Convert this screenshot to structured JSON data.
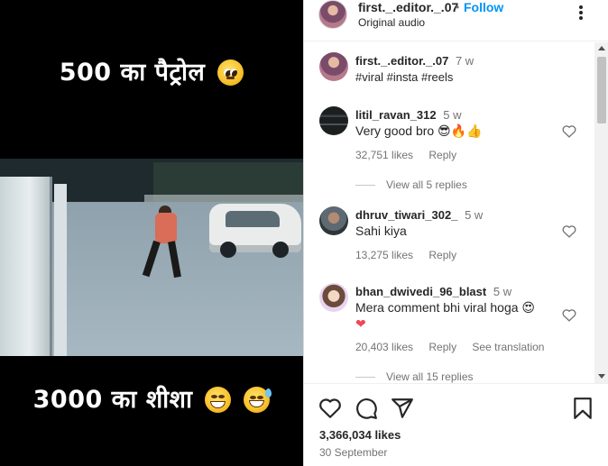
{
  "video": {
    "caption_top": "500 का पैट्रोल",
    "caption_bottom": "3000 का शीशा"
  },
  "post": {
    "author": "first._.editor._.07",
    "separator": "•",
    "follow_label": "Follow",
    "audio": "Original audio",
    "caption_user": "first._.editor._.07",
    "caption_time": "7 w",
    "hashtags": "#viral #insta #reels",
    "likes": "3,366,034 likes",
    "date": "30 September"
  },
  "comments": [
    {
      "user": "litil_ravan_312",
      "time": "5 w",
      "text": "Very good bro 😎🔥👍",
      "likes": "32,751 likes",
      "reply_label": "Reply",
      "view_replies": "View all 5 replies"
    },
    {
      "user": "dhruv_tiwari_302_",
      "time": "5 w",
      "text": "Sahi kiya",
      "likes": "13,275 likes",
      "reply_label": "Reply"
    },
    {
      "user": "bhan_dwivedi_96_blast",
      "time": "5 w",
      "text": "Mera comment bhi viral hoga 😍",
      "text2": "❤",
      "likes": "20,403 likes",
      "reply_label": "Reply",
      "translation_label": "See translation",
      "view_replies": "View all 15 replies"
    }
  ],
  "icons": {
    "more": "more-options-icon",
    "like": "heart-icon",
    "comment": "comment-icon",
    "share": "share-icon",
    "save": "bookmark-icon"
  },
  "colors": {
    "link": "#0095f6",
    "hashtag": "#00376b",
    "muted": "#737373",
    "heart_red": "#ed4956"
  }
}
